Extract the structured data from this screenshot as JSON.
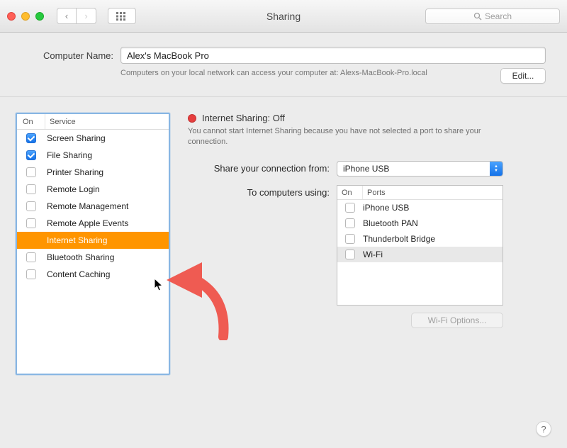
{
  "window": {
    "title": "Sharing"
  },
  "search": {
    "placeholder": "Search"
  },
  "computer_name": {
    "label": "Computer Name:",
    "value": "Alex's MacBook Pro",
    "subtext": "Computers on your local network can access your computer at: Alexs-MacBook-Pro.local",
    "edit_label": "Edit..."
  },
  "services": {
    "header_on": "On",
    "header_service": "Service",
    "items": [
      {
        "label": "Screen Sharing",
        "checked": true,
        "selected": false
      },
      {
        "label": "File Sharing",
        "checked": true,
        "selected": false
      },
      {
        "label": "Printer Sharing",
        "checked": false,
        "selected": false
      },
      {
        "label": "Remote Login",
        "checked": false,
        "selected": false
      },
      {
        "label": "Remote Management",
        "checked": false,
        "selected": false
      },
      {
        "label": "Remote Apple Events",
        "checked": false,
        "selected": false
      },
      {
        "label": "Internet Sharing",
        "checked": false,
        "selected": true
      },
      {
        "label": "Bluetooth Sharing",
        "checked": false,
        "selected": false
      },
      {
        "label": "Content Caching",
        "checked": false,
        "selected": false
      }
    ]
  },
  "detail": {
    "status_title": "Internet Sharing: Off",
    "status_desc": "You cannot start Internet Sharing because you have not selected a port to share your connection.",
    "share_from_label": "Share your connection from:",
    "share_from_value": "iPhone USB",
    "to_label": "To computers using:",
    "ports_header_on": "On",
    "ports_header_ports": "Ports",
    "ports": [
      {
        "label": "iPhone USB",
        "checked": false,
        "highlight": false
      },
      {
        "label": "Bluetooth PAN",
        "checked": false,
        "highlight": false
      },
      {
        "label": "Thunderbolt Bridge",
        "checked": false,
        "highlight": false
      },
      {
        "label": "Wi-Fi",
        "checked": false,
        "highlight": true
      }
    ],
    "wifi_options": "Wi-Fi Options..."
  },
  "colors": {
    "selection_orange": "#ff9500",
    "accent_blue": "#1a74e8",
    "annotation_red": "#ef5b52"
  }
}
